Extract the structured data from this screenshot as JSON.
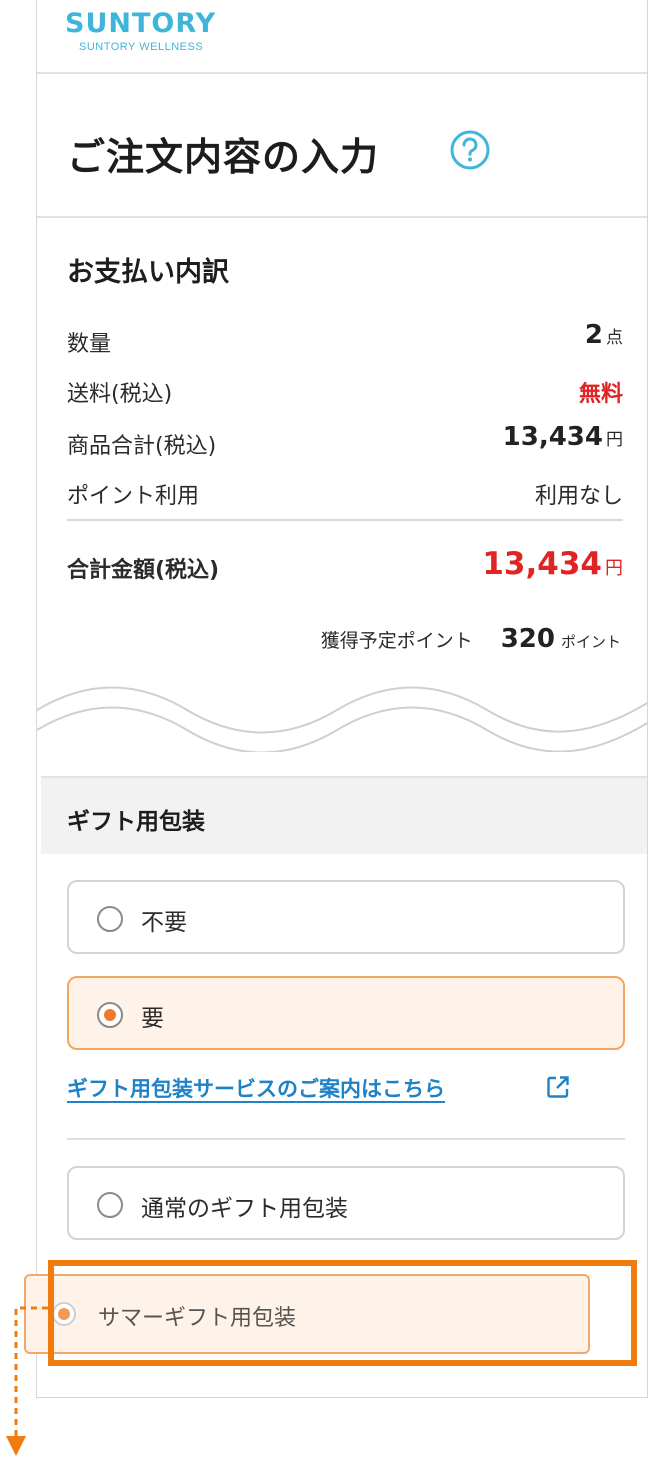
{
  "brand": {
    "name": "SUNTORY",
    "sub": "SUNTORY WELLNESS",
    "color": "#3fb6d9"
  },
  "page": {
    "title": "ご注文内容の入力",
    "help_icon": "question-circle-icon"
  },
  "summary": {
    "title": "お支払い内訳",
    "rows": [
      {
        "label": "数量",
        "value": "2",
        "unit": "点"
      },
      {
        "label": "送料(税込)",
        "value": "無料"
      },
      {
        "label": "商品合計(税込)",
        "value": "13,434",
        "unit": "円"
      },
      {
        "label": "ポイント利用",
        "value": "利用なし"
      }
    ],
    "total": {
      "label": "合計金額(税込)",
      "value": "13,434",
      "unit": "円"
    },
    "points": {
      "label": "獲得予定ポイント",
      "value": "320",
      "unit": "ポイント"
    }
  },
  "gift": {
    "title": "ギフト用包装",
    "options": [
      {
        "label": "不要",
        "selected": false
      },
      {
        "label": "要",
        "selected": true
      }
    ],
    "info_link": "ギフト用包装サービスのご案内はこちら",
    "types": [
      {
        "label": "通常のギフト用包装",
        "selected": false
      },
      {
        "label": "サマーギフト用包装",
        "selected": true
      }
    ]
  },
  "colors": {
    "accent": "#f07c10",
    "price_red": "#e02424",
    "link": "#1e82c8"
  }
}
